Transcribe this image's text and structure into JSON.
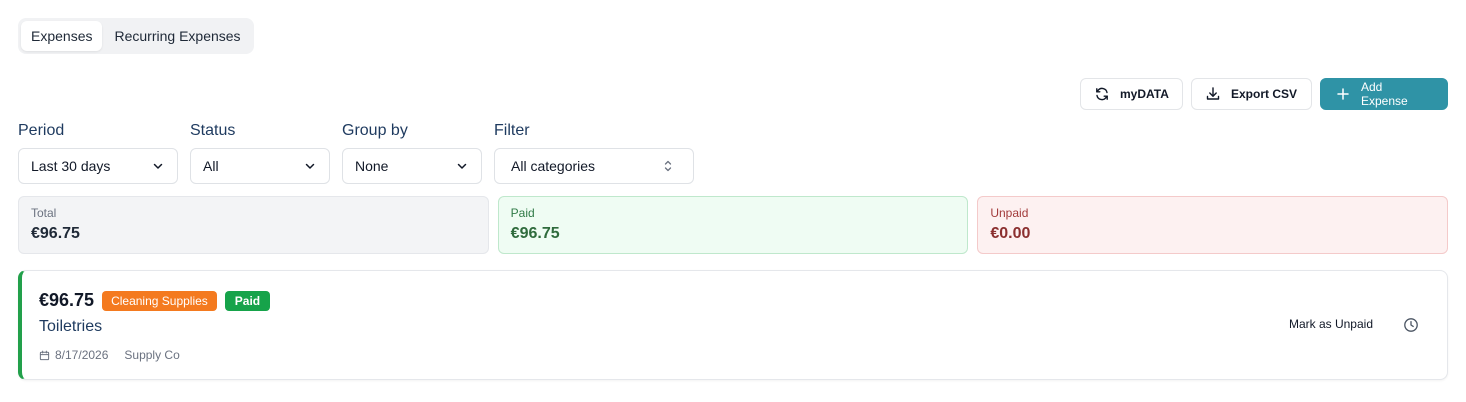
{
  "tabs": [
    {
      "label": "Expenses",
      "active": true
    },
    {
      "label": "Recurring Expenses",
      "active": false
    }
  ],
  "toolbar": {
    "mydata_label": "myDATA",
    "export_label": "Export CSV",
    "add_label": "Add Expense",
    "primary_color": "#2f93a6"
  },
  "filters": {
    "period": {
      "label": "Period",
      "value": "Last 30 days"
    },
    "status": {
      "label": "Status",
      "value": "All"
    },
    "group_by": {
      "label": "Group by",
      "value": "None"
    },
    "filter": {
      "label": "Filter",
      "value": "All categories"
    }
  },
  "summary": {
    "total": {
      "label": "Total",
      "value": "€96.75"
    },
    "paid": {
      "label": "Paid",
      "value": "€96.75"
    },
    "unpaid": {
      "label": "Unpaid",
      "value": "€0.00"
    }
  },
  "expenses": [
    {
      "amount": "€96.75",
      "category": "Cleaning Supplies",
      "status": "Paid",
      "title": "Toiletries",
      "date": "8/17/2026",
      "vendor": "Supply Co",
      "action_label": "Mark as Unpaid",
      "icons": {
        "date": "calendar-icon",
        "history": "clock-icon"
      },
      "colors": {
        "accent": "#22a04b",
        "category": "#f47a1f",
        "status": "#16a34a"
      }
    }
  ]
}
